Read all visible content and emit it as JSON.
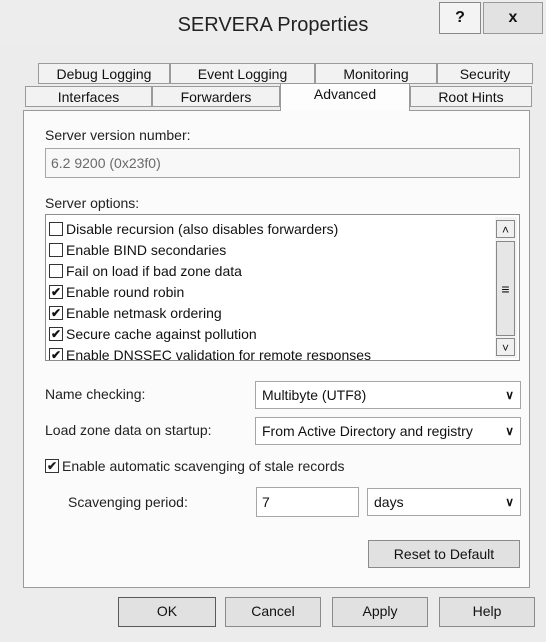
{
  "window": {
    "title": "SERVERA Properties",
    "help_label": "?",
    "close_label": "x"
  },
  "tabs": {
    "row1": [
      "Debug Logging",
      "Event Logging",
      "Monitoring",
      "Security"
    ],
    "row2": [
      "Interfaces",
      "Forwarders",
      "Advanced",
      "Root Hints"
    ],
    "active": "Advanced"
  },
  "advanced": {
    "version_label": "Server version number:",
    "version_value": "6.2 9200 (0x23f0)",
    "options_label": "Server options:",
    "options": [
      {
        "label": "Disable recursion (also disables forwarders)",
        "checked": false
      },
      {
        "label": "Enable BIND secondaries",
        "checked": false
      },
      {
        "label": "Fail on load if bad zone data",
        "checked": false
      },
      {
        "label": "Enable round robin",
        "checked": true
      },
      {
        "label": "Enable netmask ordering",
        "checked": true
      },
      {
        "label": "Secure cache against pollution",
        "checked": true
      },
      {
        "label": "Enable DNSSEC validation for remote responses",
        "checked": true
      }
    ],
    "name_checking_label": "Name checking:",
    "name_checking_value": "Multibyte (UTF8)",
    "load_zone_label": "Load zone data on startup:",
    "load_zone_value": "From Active Directory and registry",
    "scavenging_label": "Enable automatic scavenging of stale records",
    "scavenging_checked": true,
    "scavenging_period_label": "Scavenging period:",
    "scavenging_period_value": "7",
    "scavenging_unit": "days",
    "reset_label": "Reset to Default"
  },
  "footer": {
    "ok": "OK",
    "cancel": "Cancel",
    "apply": "Apply",
    "help": "Help"
  },
  "icons": {
    "check": "✔",
    "chevron_up": "˄",
    "chevron_down": "˅",
    "grip": "≡",
    "dropdown": "∨"
  }
}
